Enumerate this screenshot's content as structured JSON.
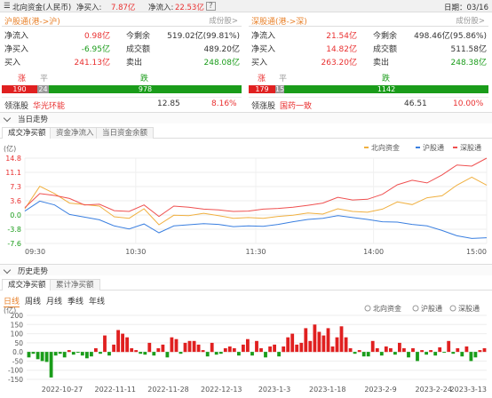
{
  "top": {
    "title": "北向资金(人民币)",
    "buy_label": "净买入:",
    "buy_val": "7.87亿",
    "in_label": "净流入:",
    "in_val": "22.53亿",
    "help": "?",
    "date": "日期：03/16"
  },
  "sh": {
    "title": "沪股通(港->沪)",
    "link": "成份股>",
    "rows": [
      [
        "净流入",
        "0.98亿",
        "今剩余",
        "519.02亿(99.81%)"
      ],
      [
        "净买入",
        "-6.95亿",
        "成交额",
        "489.20亿"
      ],
      [
        "买入",
        "241.13亿",
        "卖出",
        "248.08亿"
      ]
    ],
    "bar_head": [
      "涨",
      "平",
      "跌"
    ],
    "bar": [
      "190",
      "24",
      "978"
    ],
    "lead_label": "领涨股",
    "lead_name": "华光环能",
    "lead_price": "12.85",
    "lead_pct": "8.16%"
  },
  "sz": {
    "title": "深股通(港->深)",
    "link": "成份股>",
    "rows": [
      [
        "净流入",
        "21.54亿",
        "今剩余",
        "498.46亿(95.86%)"
      ],
      [
        "净买入",
        "14.82亿",
        "成交额",
        "511.58亿"
      ],
      [
        "买入",
        "263.20亿",
        "卖出",
        "248.38亿"
      ]
    ],
    "bar_head": [
      "涨",
      "平",
      "跌"
    ],
    "bar": [
      "179",
      "15",
      "1142"
    ],
    "lead_label": "领涨股",
    "lead_name": "国药一致",
    "lead_price": "46.51",
    "lead_pct": "10.00%"
  },
  "sec1": {
    "title": "当日走势",
    "tabs": [
      "成交净买额",
      "资金净流入",
      "当日资金余额"
    ]
  },
  "sec2": {
    "title": "历史走势",
    "tabs": [
      "成交净买额",
      "累计净买额"
    ],
    "periods": [
      "日线",
      "周线",
      "月线",
      "季线",
      "年线"
    ]
  },
  "colors": {
    "north": "#f0b040",
    "sh": "#3a7fe0",
    "sz": "#ef5050"
  },
  "chart_data": [
    {
      "type": "line",
      "unit": "(亿)",
      "legend": [
        "北向资金",
        "沪股通",
        "深股通"
      ],
      "yticks": [
        "14.8",
        "11.1",
        "7.3",
        "3.6",
        "0.0",
        "-3.8",
        "-7.6"
      ],
      "ylim": [
        -7.6,
        14.8
      ],
      "xticks": [
        "09:30",
        "10:30",
        "11:30",
        "14:00",
        "15:00"
      ],
      "series": [
        {
          "name": "北向资金",
          "values": [
            1.5,
            7.4,
            5.5,
            3.0,
            2.6,
            2.2,
            -0.6,
            -1.0,
            1.5,
            -2.7,
            -0.2,
            -0.3,
            0.3,
            -0.3,
            -1.0,
            -0.8,
            -1.0,
            -0.5,
            -0.2,
            0.4,
            0.1,
            1.5,
            0.8,
            0.6,
            1.4,
            3.3,
            2.6,
            4.4,
            4.9,
            7.7,
            9.8,
            7.7
          ]
        },
        {
          "name": "沪股通",
          "values": [
            0.9,
            3.5,
            2.5,
            0.0,
            -0.7,
            -1.4,
            -3.0,
            -3.8,
            -2.5,
            -4.8,
            -3.0,
            -2.7,
            -2.4,
            -2.6,
            -3.2,
            -3.0,
            -3.1,
            -2.6,
            -1.9,
            -1.3,
            -1.0,
            -0.3,
            -0.8,
            -1.3,
            -1.9,
            -2.0,
            -2.6,
            -3.0,
            -4.2,
            -5.6,
            -6.3,
            -6.1
          ]
        },
        {
          "name": "深股通",
          "values": [
            1.8,
            5.5,
            5.0,
            4.2,
            2.5,
            2.7,
            1.0,
            0.8,
            2.5,
            -0.5,
            2.2,
            1.9,
            1.4,
            1.2,
            0.8,
            0.9,
            1.4,
            1.6,
            1.9,
            2.4,
            3.0,
            4.5,
            3.8,
            4.0,
            5.3,
            7.8,
            9.0,
            8.3,
            10.4,
            13.0,
            12.7,
            14.8
          ]
        }
      ]
    },
    {
      "type": "bar",
      "unit": "(亿)",
      "legend": [
        "北向资金",
        "沪股通",
        "深股通"
      ],
      "yticks": [
        "200",
        "150",
        "100",
        "50",
        "0.0",
        "-50",
        "-100",
        "-150"
      ],
      "ylim": [
        -150,
        200
      ],
      "xticks": [
        "2022-10-27",
        "2022-11-11",
        "2022-11-28",
        "2022-12-13",
        "2023-1-3",
        "2023-1-18",
        "2023-2-9",
        "2023-2-24",
        "2023-3-13"
      ],
      "values": [
        -30,
        -10,
        -40,
        -50,
        -55,
        -140,
        -20,
        -10,
        -30,
        10,
        -15,
        -5,
        -20,
        -35,
        -25,
        20,
        -10,
        90,
        -20,
        40,
        120,
        100,
        80,
        20,
        10,
        -10,
        -15,
        50,
        -20,
        20,
        40,
        -30,
        80,
        70,
        -10,
        50,
        60,
        60,
        40,
        10,
        -25,
        50,
        -15,
        -10,
        20,
        30,
        20,
        -20,
        40,
        70,
        -20,
        60,
        20,
        -30,
        30,
        40,
        -25,
        30,
        80,
        100,
        40,
        50,
        130,
        60,
        150,
        110,
        90,
        130,
        30,
        80,
        140,
        80,
        20,
        -10,
        10,
        -25,
        -25,
        60,
        20,
        -20,
        30,
        20,
        -15,
        50,
        20,
        -30,
        20,
        -50,
        10,
        -15,
        10,
        -20,
        25,
        -5,
        60,
        -10,
        20,
        -25,
        30,
        -50,
        -30,
        10,
        20
      ]
    }
  ]
}
